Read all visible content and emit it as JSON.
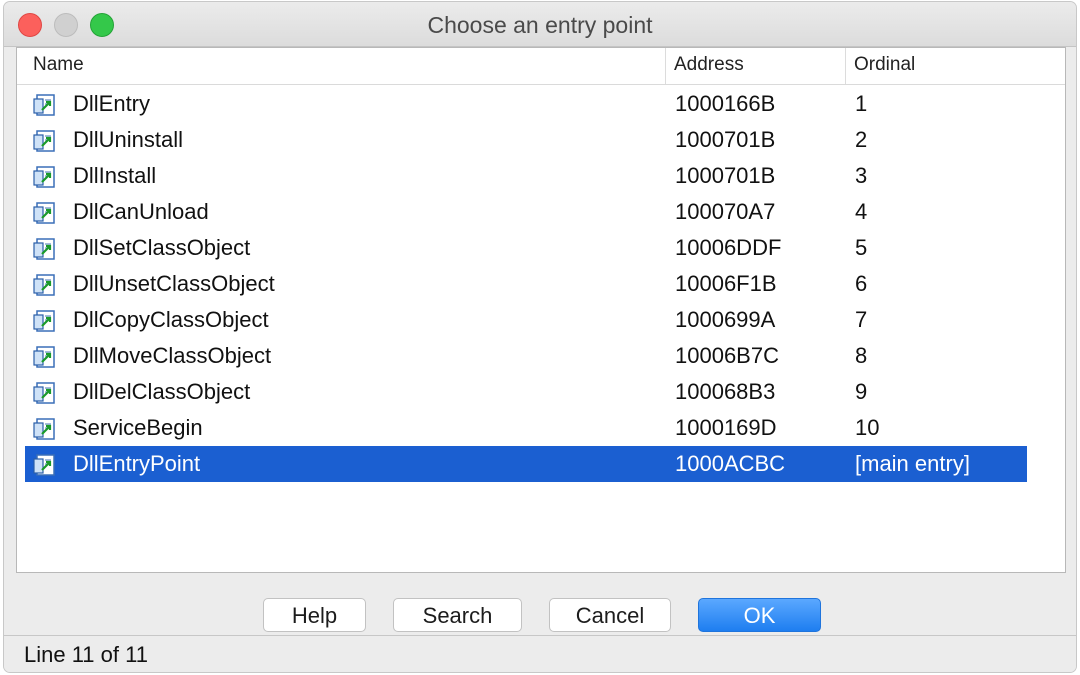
{
  "window": {
    "title": "Choose an entry point"
  },
  "columns": {
    "name": "Name",
    "address": "Address",
    "ordinal": "Ordinal"
  },
  "rows": [
    {
      "name": "DllEntry",
      "address": "1000166B",
      "ordinal": "1"
    },
    {
      "name": "DllUninstall",
      "address": "1000701B",
      "ordinal": "2"
    },
    {
      "name": "DllInstall",
      "address": "1000701B",
      "ordinal": "3"
    },
    {
      "name": "DllCanUnload",
      "address": "100070A7",
      "ordinal": "4"
    },
    {
      "name": "DllSetClassObject",
      "address": "10006DDF",
      "ordinal": "5"
    },
    {
      "name": "DllUnsetClassObject",
      "address": "10006F1B",
      "ordinal": "6"
    },
    {
      "name": "DllCopyClassObject",
      "address": "1000699A",
      "ordinal": "7"
    },
    {
      "name": "DllMoveClassObject",
      "address": "10006B7C",
      "ordinal": "8"
    },
    {
      "name": "DllDelClassObject",
      "address": "100068B3",
      "ordinal": "9"
    },
    {
      "name": "ServiceBegin",
      "address": "1000169D",
      "ordinal": "10"
    },
    {
      "name": "DllEntryPoint",
      "address": "1000ACBC",
      "ordinal": "[main entry]",
      "selected": true
    }
  ],
  "row_icon": "function-entry-icon",
  "buttons": {
    "help": "Help",
    "search": "Search",
    "cancel": "Cancel",
    "ok": "OK"
  },
  "status": {
    "text": "Line 11 of 11"
  },
  "colors": {
    "selection": "#1b5fd1",
    "ok_button": "#1e7ef0"
  }
}
